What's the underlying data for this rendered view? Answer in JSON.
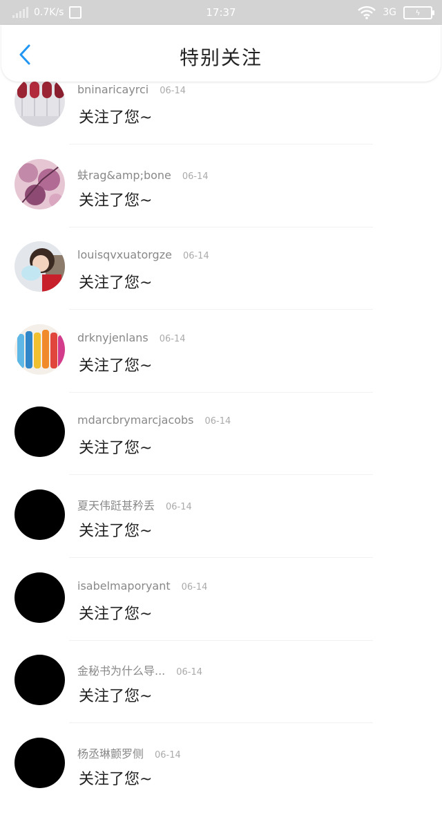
{
  "status_bar": {
    "speed": "0.7K/s",
    "time": "17:37",
    "network": "3G",
    "battery_icon": "charging-battery-icon"
  },
  "header": {
    "title": "特别关注",
    "back_icon": "chevron-left-icon",
    "accent_color": "#2196F3"
  },
  "items": [
    {
      "name": "bninaricayrci",
      "date": "06-14",
      "message": "关注了您~",
      "avatar": "wine-glasses-photo"
    },
    {
      "name": "蚨rag&amp;bone",
      "date": "06-14",
      "message": "关注了您~",
      "avatar": "pink-flowers-photo"
    },
    {
      "name": "louisqvxuatorgze",
      "date": "06-14",
      "message": "关注了您~",
      "avatar": "child-cotton-candy-photo"
    },
    {
      "name": "drknyjenlans",
      "date": "06-14",
      "message": "关注了您~",
      "avatar": "colorful-bottles-photo"
    },
    {
      "name": "mdarcbrymarcjacobs",
      "date": "06-14",
      "message": "关注了您~",
      "avatar": "black-circle"
    },
    {
      "name": "夏天伟跹甚矜丢",
      "date": "06-14",
      "message": "关注了您~",
      "avatar": "black-circle"
    },
    {
      "name": "isabelmaporyant",
      "date": "06-14",
      "message": "关注了您~",
      "avatar": "black-circle"
    },
    {
      "name": "金秘书为什么导...",
      "date": "06-14",
      "message": "关注了您~",
      "avatar": "black-circle"
    },
    {
      "name": "杨丞琳颤罗侧",
      "date": "06-14",
      "message": "关注了您~",
      "avatar": "black-circle"
    }
  ]
}
